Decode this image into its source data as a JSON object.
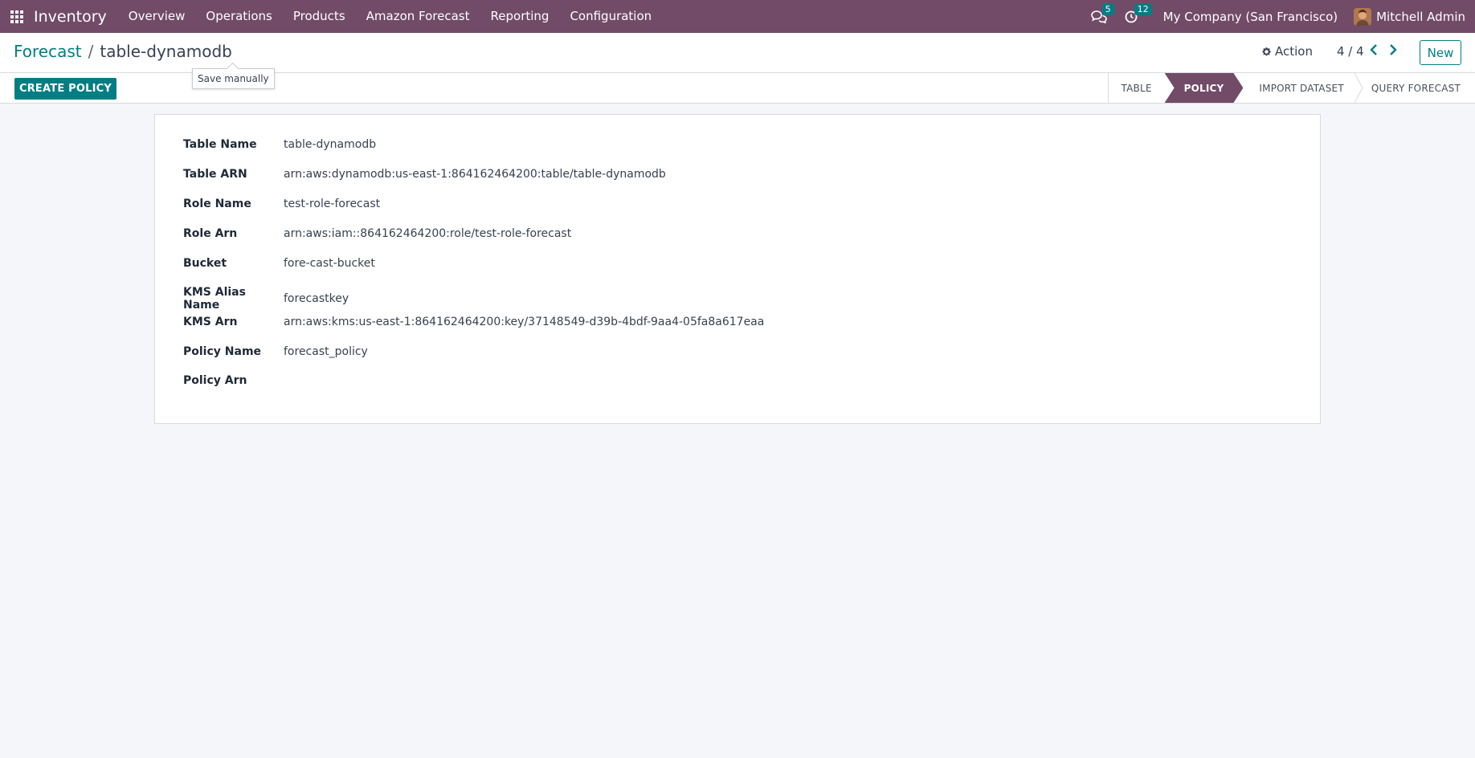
{
  "navbar": {
    "app_name": "Inventory",
    "menu": [
      "Overview",
      "Operations",
      "Products",
      "Amazon Forecast",
      "Reporting",
      "Configuration"
    ],
    "messages_count": "5",
    "activities_count": "12",
    "company": "My Company (San Francisco)",
    "user": "Mitchell Admin",
    "bg_color": "#714b67"
  },
  "breadcrumb": {
    "parent": "Forecast",
    "separator": "/",
    "current": "table-dynamodb"
  },
  "tooltip": "Save manually",
  "control": {
    "action_label": "Action",
    "pager": "4 / 4",
    "new_label": "New"
  },
  "statusbar": {
    "button_label": "CREATE POLICY",
    "stages": [
      "TABLE",
      "POLICY",
      "IMPORT DATASET",
      "QUERY FORECAST"
    ],
    "active_stage": "POLICY"
  },
  "form": {
    "fields": [
      {
        "label": "Table Name",
        "value": "table-dynamodb"
      },
      {
        "label": "Table ARN",
        "value": "arn:aws:dynamodb:us-east-1:864162464200:table/table-dynamodb"
      },
      {
        "label": "Role Name",
        "value": "test-role-forecast"
      },
      {
        "label": "Role Arn",
        "value": "arn:aws:iam::864162464200:role/test-role-forecast"
      },
      {
        "label": "Bucket",
        "value": "fore-cast-bucket"
      },
      {
        "label": "KMS Alias Name",
        "value": "forecastkey"
      },
      {
        "label": "KMS Arn",
        "value": "arn:aws:kms:us-east-1:864162464200:key/37148549-d39b-4bdf-9aa4-05fa8a617eaa"
      },
      {
        "label": "Policy Name",
        "value": "forecast_policy"
      },
      {
        "label": "Policy Arn",
        "value": ""
      }
    ]
  },
  "colors": {
    "primary": "#714b67",
    "accent": "#017e84"
  }
}
